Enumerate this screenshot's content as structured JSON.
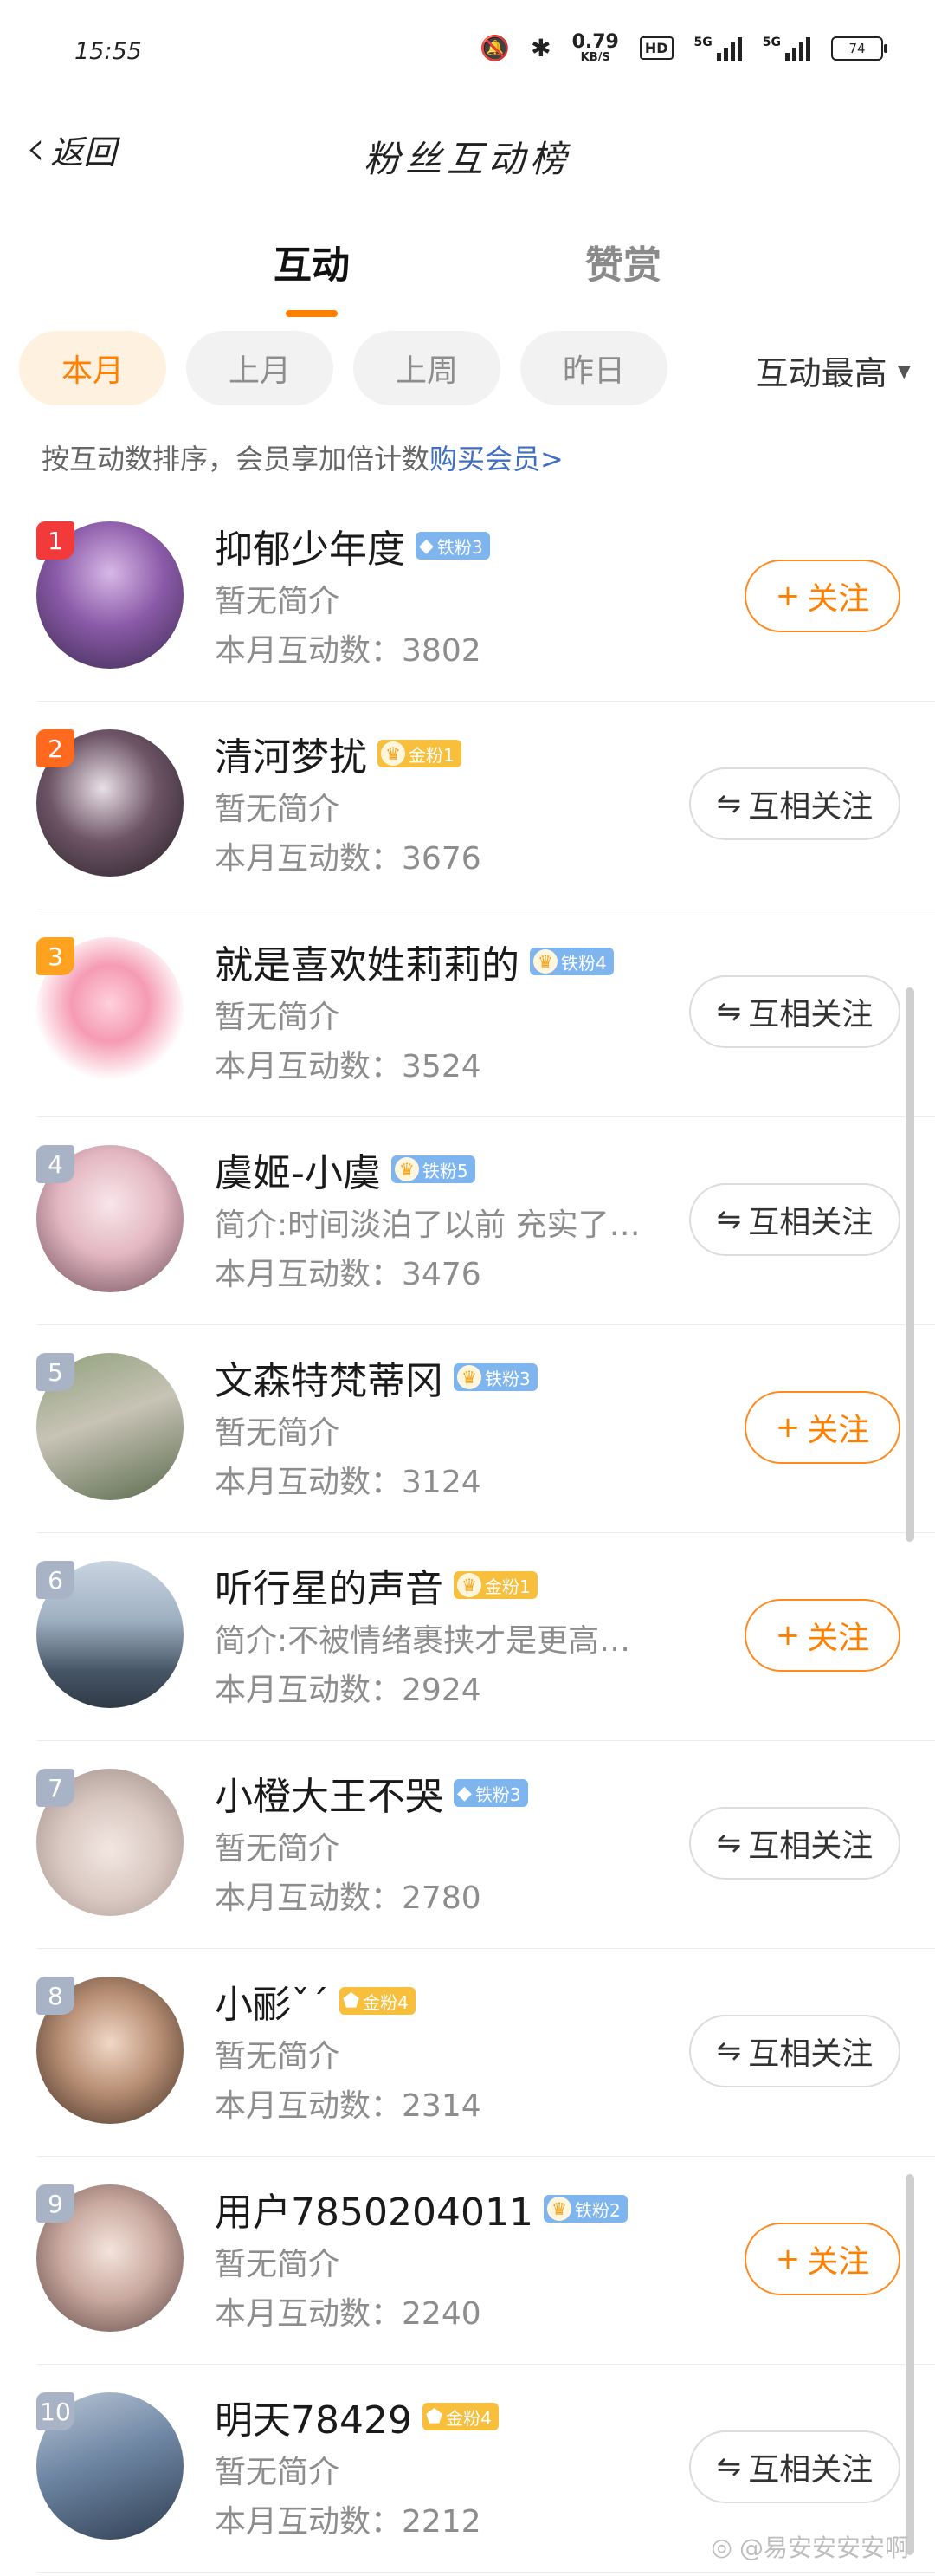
{
  "status_bar": {
    "time": "15:55",
    "net_speed_value": "0.79",
    "net_speed_unit": "KB/S",
    "hd_label": "HD",
    "signal_1": "5G",
    "signal_2": "5G",
    "battery": "74"
  },
  "nav": {
    "back_label": "返回",
    "title": "粉丝互动榜"
  },
  "tabs": [
    {
      "label": "互动",
      "active": true
    },
    {
      "label": "赞赏",
      "active": false
    }
  ],
  "filters": {
    "chips": [
      {
        "label": "本月",
        "active": true
      },
      {
        "label": "上月",
        "active": false
      },
      {
        "label": "上周",
        "active": false
      },
      {
        "label": "昨日",
        "active": false
      }
    ],
    "sort_label": "互动最高"
  },
  "tip": {
    "text": "按互动数排序，会员享加倍计数",
    "link": "购买会员>"
  },
  "count_prefix": "本月互动数：",
  "fans": [
    {
      "rank": "1",
      "name": "抑郁少年度",
      "badge": "铁粉3",
      "badge_type": "iron",
      "badge_icon": "diamond",
      "bio": "暂无简介",
      "count": "3802",
      "action": "关注",
      "action_type": "follow"
    },
    {
      "rank": "2",
      "name": "清河梦扰",
      "badge": "金粉1",
      "badge_type": "gold",
      "badge_icon": "crown",
      "bio": "暂无简介",
      "count": "3676",
      "action": "互相关注",
      "action_type": "mutual"
    },
    {
      "rank": "3",
      "name": "就是喜欢姓莉莉的",
      "badge": "铁粉4",
      "badge_type": "iron",
      "badge_icon": "crown",
      "bio": "暂无简介",
      "count": "3524",
      "action": "互相关注",
      "action_type": "mutual"
    },
    {
      "rank": "4",
      "name": "虞姬-小虞",
      "badge": "铁粉5",
      "badge_type": "iron",
      "badge_icon": "crown",
      "bio": "简介:时间淡泊了以前 充实了…",
      "count": "3476",
      "action": "互相关注",
      "action_type": "mutual"
    },
    {
      "rank": "5",
      "name": "文森特梵蒂冈",
      "badge": "铁粉3",
      "badge_type": "iron",
      "badge_icon": "crown",
      "bio": "暂无简介",
      "count": "3124",
      "action": "关注",
      "action_type": "follow"
    },
    {
      "rank": "6",
      "name": "听行星的声音",
      "badge": "金粉1",
      "badge_type": "gold",
      "badge_icon": "crown",
      "bio": "简介:不被情绪裹挟才是更高级的自由",
      "count": "2924",
      "action": "关注",
      "action_type": "follow"
    },
    {
      "rank": "7",
      "name": "小橙大王不哭",
      "badge": "铁粉3",
      "badge_type": "iron",
      "badge_icon": "diamond",
      "bio": "暂无简介",
      "count": "2780",
      "action": "互相关注",
      "action_type": "mutual"
    },
    {
      "rank": "8",
      "name": "小彨ˇˊ",
      "badge": "金粉4",
      "badge_type": "gold",
      "badge_icon": "gem",
      "bio": "暂无简介",
      "count": "2314",
      "action": "互相关注",
      "action_type": "mutual"
    },
    {
      "rank": "9",
      "name": "用户7850204011",
      "badge": "铁粉2",
      "badge_type": "iron",
      "badge_icon": "crown",
      "bio": "暂无简介",
      "count": "2240",
      "action": "关注",
      "action_type": "follow"
    },
    {
      "rank": "10",
      "name": "明天78429",
      "badge": "金粉4",
      "badge_type": "gold",
      "badge_icon": "gem",
      "bio": "暂无简介",
      "count": "2212",
      "action": "互相关注",
      "action_type": "mutual"
    }
  ],
  "rank_colors": {
    "1": "#f23a3a",
    "2": "#ff6a1f",
    "3": "#ffa21f",
    "default": "#a9b3c6"
  },
  "accent": "#ff7f00",
  "watermark": "@易安安安安啊"
}
